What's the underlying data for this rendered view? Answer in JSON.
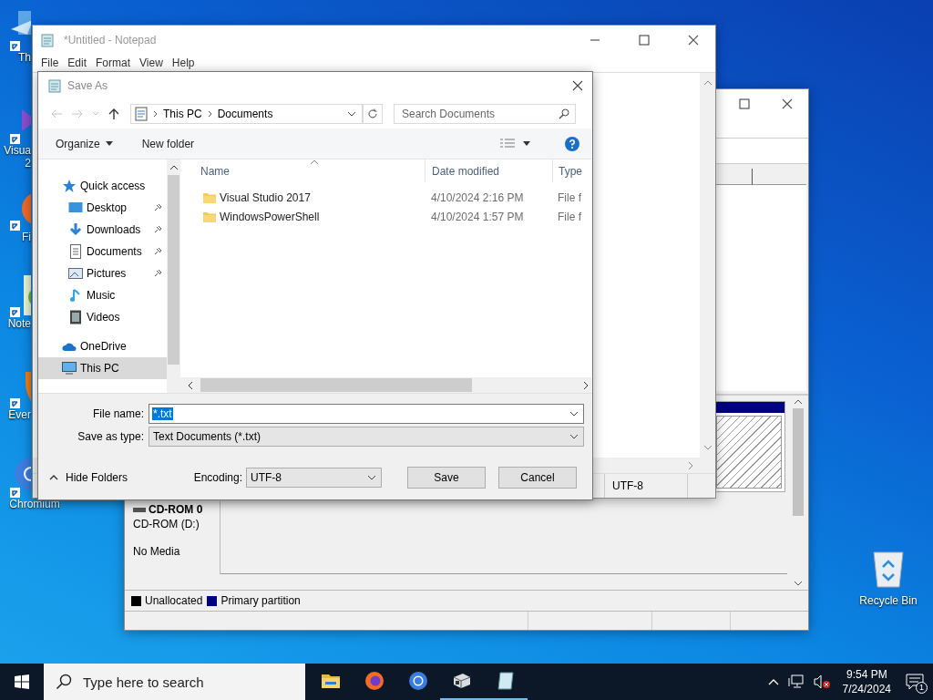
{
  "desktop": {
    "icons": [
      {
        "kind": "monitor",
        "label_lines": [
          "Th"
        ],
        "clipped": true
      },
      {
        "kind": "ribbon",
        "label_lines": [
          "Visua",
          "2"
        ],
        "clipped": true
      },
      {
        "kind": "fox",
        "label_lines": [
          "Fi"
        ],
        "clipped": true
      },
      {
        "kind": "chameleon",
        "label_lines": [
          "Note"
        ],
        "clipped": true
      },
      {
        "kind": "elephant",
        "label_lines": [
          "Ever"
        ],
        "clipped": true
      },
      {
        "kind": "globe",
        "label_lines": [
          "Chromium"
        ],
        "clipped": false
      }
    ],
    "recycle_bin": {
      "label": "Recycle Bin"
    }
  },
  "disk_management": {
    "cd_rom": {
      "name": "CD-ROM 0",
      "drive": "CD-ROM (D:)",
      "status": "No Media"
    },
    "legend": [
      {
        "label": "Unallocated",
        "color": "#000000"
      },
      {
        "label": "Primary partition",
        "color": "#000080"
      }
    ]
  },
  "notepad": {
    "title": "*Untitled - Notepad",
    "menu": [
      "File",
      "Edit",
      "Format",
      "View",
      "Help"
    ],
    "status_bar": {
      "encoding": "UTF-8"
    }
  },
  "save_dialog": {
    "title": "Save As",
    "breadcrumb": [
      "This PC",
      "Documents"
    ],
    "search": {
      "placeholder": "Search Documents"
    },
    "organize": "Organize",
    "new_folder": "New folder",
    "nav": [
      {
        "kind": "star",
        "label": "Quick access",
        "selected": false,
        "children": [
          {
            "kind": "desktop",
            "label": "Desktop",
            "pinned": true,
            "selected": false
          },
          {
            "kind": "download",
            "label": "Downloads",
            "pinned": true,
            "selected": false
          },
          {
            "kind": "document",
            "label": "Documents",
            "pinned": true,
            "selected": false
          },
          {
            "kind": "picture",
            "label": "Pictures",
            "pinned": true,
            "selected": false
          },
          {
            "kind": "music",
            "label": "Music",
            "pinned": false,
            "selected": false
          },
          {
            "kind": "video",
            "label": "Videos",
            "pinned": false,
            "selected": false
          }
        ]
      },
      {
        "kind": "cloud",
        "label": "OneDrive",
        "selected": false
      },
      {
        "kind": "pc",
        "label": "This PC",
        "selected": true
      }
    ],
    "columns": [
      "Name",
      "Date modified",
      "Type"
    ],
    "files": [
      {
        "name": "Visual Studio 2017",
        "date": "4/10/2024 2:16 PM",
        "type": "File f"
      },
      {
        "name": "WindowsPowerShell",
        "date": "4/10/2024 1:57 PM",
        "type": "File f"
      }
    ],
    "file_name": {
      "label": "File name:",
      "value": "*.txt",
      "selected": true
    },
    "save_as_type": {
      "label": "Save as type:",
      "value": "Text Documents (*.txt)"
    },
    "hide_folders": "Hide Folders",
    "encoding": {
      "label": "Encoding:",
      "value": "UTF-8"
    },
    "buttons": [
      "Save",
      "Cancel"
    ]
  },
  "taskbar": {
    "search": {
      "placeholder": "Type here to search"
    },
    "apps": [
      {
        "kind": "folder",
        "running": false
      },
      {
        "kind": "fox",
        "running": false
      },
      {
        "kind": "globe",
        "running": false
      },
      {
        "kind": "box",
        "running": true
      },
      {
        "kind": "pad",
        "running": true
      }
    ],
    "time": "9:54 PM",
    "date": "7/24/2024",
    "notifications": "1"
  }
}
